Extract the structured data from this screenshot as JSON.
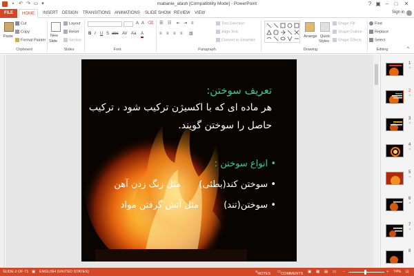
{
  "window": {
    "title": "mabanie_atash [Compatibility Mode] - PowerPoint",
    "sign_in": "Sign in"
  },
  "tabs": [
    "FILE",
    "HOME",
    "INSERT",
    "DESIGN",
    "TRANSITIONS",
    "ANIMATIONS",
    "SLIDE SHOW",
    "REVIEW",
    "VIEW"
  ],
  "ribbon": {
    "clipboard": {
      "paste": "Paste",
      "cut": "Cut",
      "copy": "Copy",
      "format_painter": "Format Painter",
      "label": "Clipboard"
    },
    "slides": {
      "new_slide": "New",
      "new_slide2": "Slide",
      "layout": "Layout",
      "reset": "Reset",
      "section": "Section",
      "label": "Slides"
    },
    "font": {
      "label": "Font"
    },
    "paragraph": {
      "text_direction": "Text Direction",
      "align_text": "Align Text",
      "convert": "Convert to SmartArt",
      "label": "Paragraph"
    },
    "drawing": {
      "arrange": "Arrange",
      "quick_styles": "Quick",
      "quick_styles2": "Styles",
      "shape_fill": "Shape Fill",
      "shape_outline": "Shape Outline",
      "shape_effects": "Shape Effects",
      "label": "Drawing"
    },
    "editing": {
      "find": "Find",
      "replace": "Replace",
      "select": "Select",
      "label": "Editing"
    }
  },
  "slide": {
    "title": "تعریف سوختن:",
    "line1": "هر ماده ای که با اکسیژن ترکیب شود ، ترکیب",
    "line2": "حاصل را سوختن گویند.",
    "types_heading": "انواع سوختن   :",
    "b1_left": "مثل زنگ زدن آهن",
    "b1_right": "سوختن کند(بطئی)",
    "b2_left": "مثل آتش گرفتن مواد",
    "b2_right": "سوختن(تند)",
    "title_color": "#33cc99",
    "text_color": "#ffffff"
  },
  "thumbnails": [
    {
      "num": "1",
      "star": "*"
    },
    {
      "num": "2",
      "star": "*"
    },
    {
      "num": "3",
      "star": "*"
    },
    {
      "num": "4",
      "star": "*"
    },
    {
      "num": "5",
      "star": "*"
    },
    {
      "num": "6",
      "star": "*"
    },
    {
      "num": "7",
      "star": "*"
    },
    {
      "num": "8",
      "star": ""
    }
  ],
  "status": {
    "slide": "SLIDE 2 OF 71",
    "language": "ENGLISH (UNITED STATES)",
    "notes": "NOTES",
    "comments": "COMMENTS",
    "zoom": "74%"
  },
  "colors": {
    "accent": "#d24726"
  }
}
